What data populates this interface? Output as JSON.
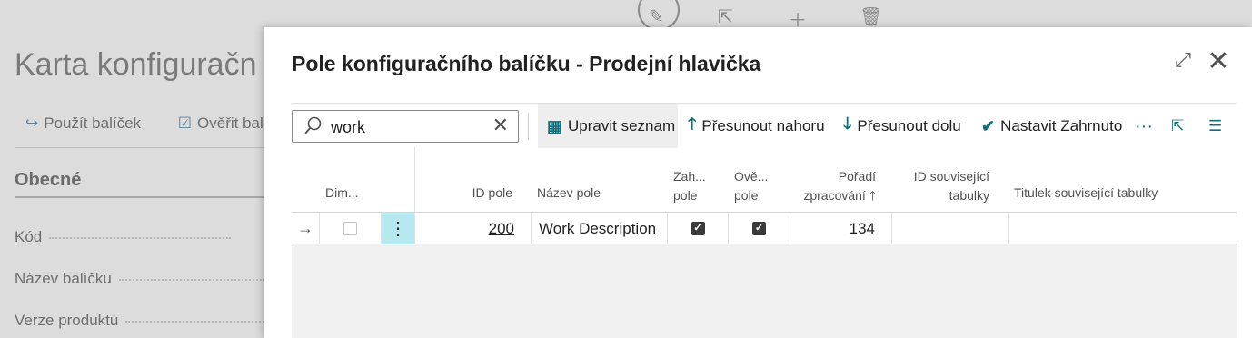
{
  "background": {
    "page_title": "Karta konfiguračn",
    "actions": [
      "Použít balíček",
      "Ověřit balíč"
    ],
    "section_title": "Obecné",
    "fields": [
      "Kód",
      "Název balíčku",
      "Verze produktu"
    ]
  },
  "dialog": {
    "title": "Pole konfiguračního balíčku - Prodejní hlavička",
    "search": {
      "value": "work"
    },
    "toolbar": {
      "edit_list": "Upravit seznam",
      "move_up": "Přesunout nahoru",
      "move_down": "Přesunout dolu",
      "set_included": "Nastavit Zahrnuto",
      "more": "···"
    },
    "columns": {
      "dim": "Dim...",
      "field_id": "ID pole",
      "field_name": "Název pole",
      "included_1": "Zah...",
      "included_2": "pole",
      "validate_1": "Ově...",
      "validate_2": "pole",
      "order_1": "Pořadí",
      "order_2": "zpracování",
      "related_id_1": "ID související",
      "related_id_2": "tabulky",
      "related_caption": "Titulek související tabulky"
    },
    "rows": [
      {
        "dimension": false,
        "field_id": "200",
        "field_name": "Work Description",
        "included": true,
        "validate": true,
        "processing_order": "134",
        "related_table_id": "",
        "related_table_caption": ""
      }
    ]
  },
  "colors": {
    "accent": "#0e6e7a",
    "selected_row_marker": "#b5e9ef"
  }
}
